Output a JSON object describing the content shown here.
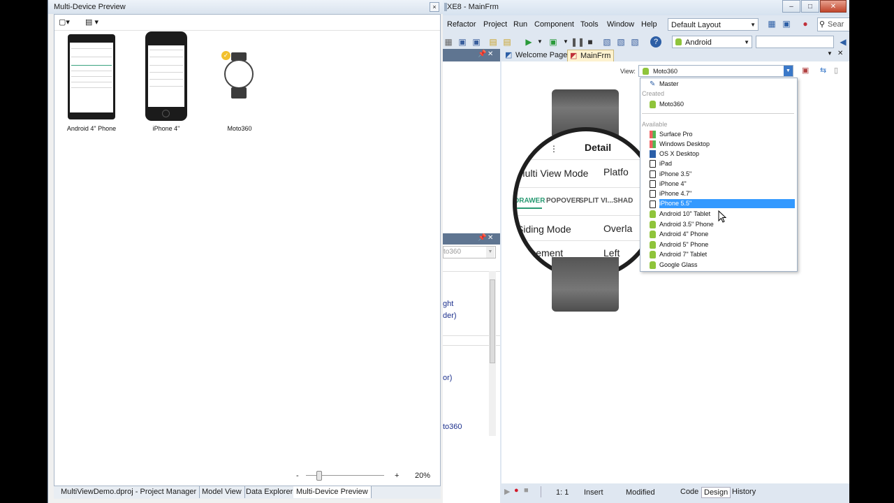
{
  "preview_window": {
    "title": "Multi-Device Preview",
    "devices": [
      {
        "label": "Android 4\" Phone"
      },
      {
        "label": "iPhone 4\""
      },
      {
        "label": "Moto360"
      }
    ],
    "zoom": {
      "minus": "-",
      "plus": "+",
      "value": "20%"
    },
    "bottom_tabs": [
      "MultiViewDemo.dproj - Project Manager",
      "Model View",
      "Data Explorer",
      "Multi-Device Preview"
    ]
  },
  "ide": {
    "title": "XE8 - MainFrm",
    "menu": [
      "Refactor",
      "Project",
      "Run",
      "Component",
      "Tools",
      "Window",
      "Help"
    ],
    "layout_combo": "Default Layout",
    "search_text": "Sear",
    "platform_combo": "Android",
    "doc_tabs": [
      "Welcome Page",
      "MainFrm"
    ],
    "view_label": "View:",
    "view_combo": "Moto360",
    "side_panel_text": [
      "to360",
      "ght",
      "der)",
      "or)",
      "to360"
    ],
    "design": {
      "header": "Detail",
      "row1_label": "Multi View Mode",
      "row1_value": "Platfo",
      "tabs": [
        "DRAWER",
        "POPOVER",
        "SPLIT VI...",
        "SHAD"
      ],
      "row2_label": "Siding Mode",
      "row2_value": "Overla",
      "row3_label": "Placement",
      "row3_value": "Left"
    },
    "status": {
      "position": "1:   1",
      "mode": "Insert",
      "state": "Modified",
      "tabs": [
        "Code",
        "Design",
        "History"
      ]
    }
  },
  "view_dropdown": {
    "master": "Master",
    "created_header": "Created",
    "created": [
      {
        "label": "Moto360",
        "icon": "android-icon"
      }
    ],
    "available_header": "Available",
    "available": [
      {
        "label": "Surface Pro",
        "icon": "windows-icon"
      },
      {
        "label": "Windows Desktop",
        "icon": "windows-icon"
      },
      {
        "label": "OS X Desktop",
        "icon": "osx-icon"
      },
      {
        "label": "iPad",
        "icon": "iphone-icon"
      },
      {
        "label": "iPhone 3.5\"",
        "icon": "iphone-icon"
      },
      {
        "label": "iPhone 4\"",
        "icon": "iphone-icon"
      },
      {
        "label": "iPhone 4.7\"",
        "icon": "iphone-icon"
      },
      {
        "label": "iPhone 5.5\"",
        "icon": "iphone-icon"
      },
      {
        "label": "Android 10\" Tablet",
        "icon": "android-icon"
      },
      {
        "label": "Android 3.5\" Phone",
        "icon": "android-icon"
      },
      {
        "label": "Android 4\" Phone",
        "icon": "android-icon"
      },
      {
        "label": "Android 5\" Phone",
        "icon": "android-icon"
      },
      {
        "label": "Android 7\" Tablet",
        "icon": "android-icon"
      },
      {
        "label": "Google Glass",
        "icon": "android-icon"
      }
    ],
    "selected": "iPhone 5.5\""
  }
}
